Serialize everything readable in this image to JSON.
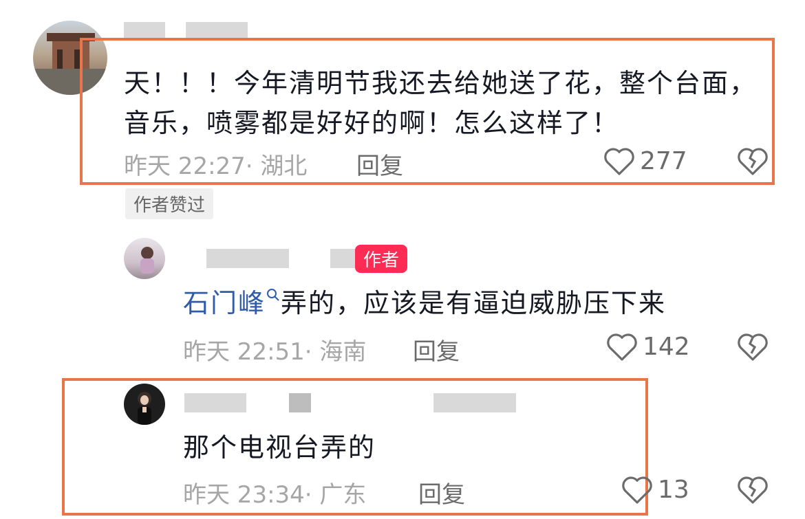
{
  "comments": [
    {
      "text": "天！！！今年清明节我还去给她送了花，整个台面，音乐，喷雾都是好好的啊！怎么这样了！",
      "time": "昨天 22:27",
      "location": "· 湖北",
      "reply_label": "回复",
      "likes": "277",
      "badge": "作者赞过"
    },
    {
      "author_badge": "作者",
      "mention": "石门峰",
      "text": "弄的，应该是有逼迫威胁压下来",
      "time": "昨天 22:51",
      "location": "· 海南",
      "reply_label": "回复",
      "likes": "142"
    },
    {
      "text": "那个电视台弄的",
      "time": "昨天 23:34",
      "location": "· 广东",
      "reply_label": "回复",
      "likes": "13"
    }
  ],
  "colors": {
    "highlight": "#e8764a",
    "author_badge": "#fe2c55",
    "mention": "#2f5caa",
    "meta": "#a6a6a6"
  },
  "icons": {
    "like": "heart-outline-icon",
    "dislike": "broken-heart-icon",
    "mention": "search-icon"
  }
}
